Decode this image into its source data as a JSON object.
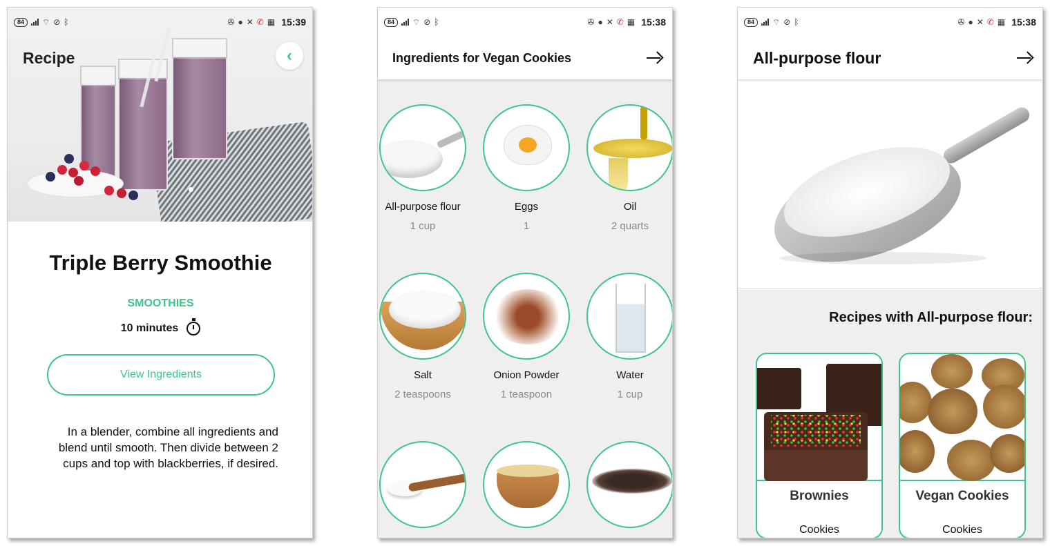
{
  "status": {
    "battery": "84",
    "time1": "15:39",
    "time2": "15:38",
    "time3": "15:38"
  },
  "recipe": {
    "header": "Recipe",
    "back_icon": "chevron-left-icon",
    "title": "Triple Berry Smoothie",
    "category": "SMOOTHIES",
    "time": "10 minutes",
    "view_button": "View Ingredients",
    "description": "In a blender, combine all ingredients and blend until smooth. Then divide between 2 cups and top with blackberries, if desired.",
    "accent": "#3ec58a"
  },
  "ingredients": {
    "title": "Ingredients for Vegan Cookies",
    "forward_icon": "arrow-right-icon",
    "items": [
      {
        "name": "All-purpose flour",
        "qty": "1 cup"
      },
      {
        "name": "Eggs",
        "qty": "1"
      },
      {
        "name": "Oil",
        "qty": "2 quarts"
      },
      {
        "name": "Salt",
        "qty": "2 teaspoons"
      },
      {
        "name": "Onion Powder",
        "qty": "1 teaspoon"
      },
      {
        "name": "Water",
        "qty": "1 cup"
      }
    ]
  },
  "ingredient_detail": {
    "title": "All-purpose flour",
    "forward_icon": "arrow-right-icon",
    "recipes_heading": "Recipes with All-purpose flour:",
    "recipes": [
      {
        "title": "Brownies",
        "category": "Cookies"
      },
      {
        "title": "Vegan Cookies",
        "category": "Cookies"
      }
    ]
  }
}
